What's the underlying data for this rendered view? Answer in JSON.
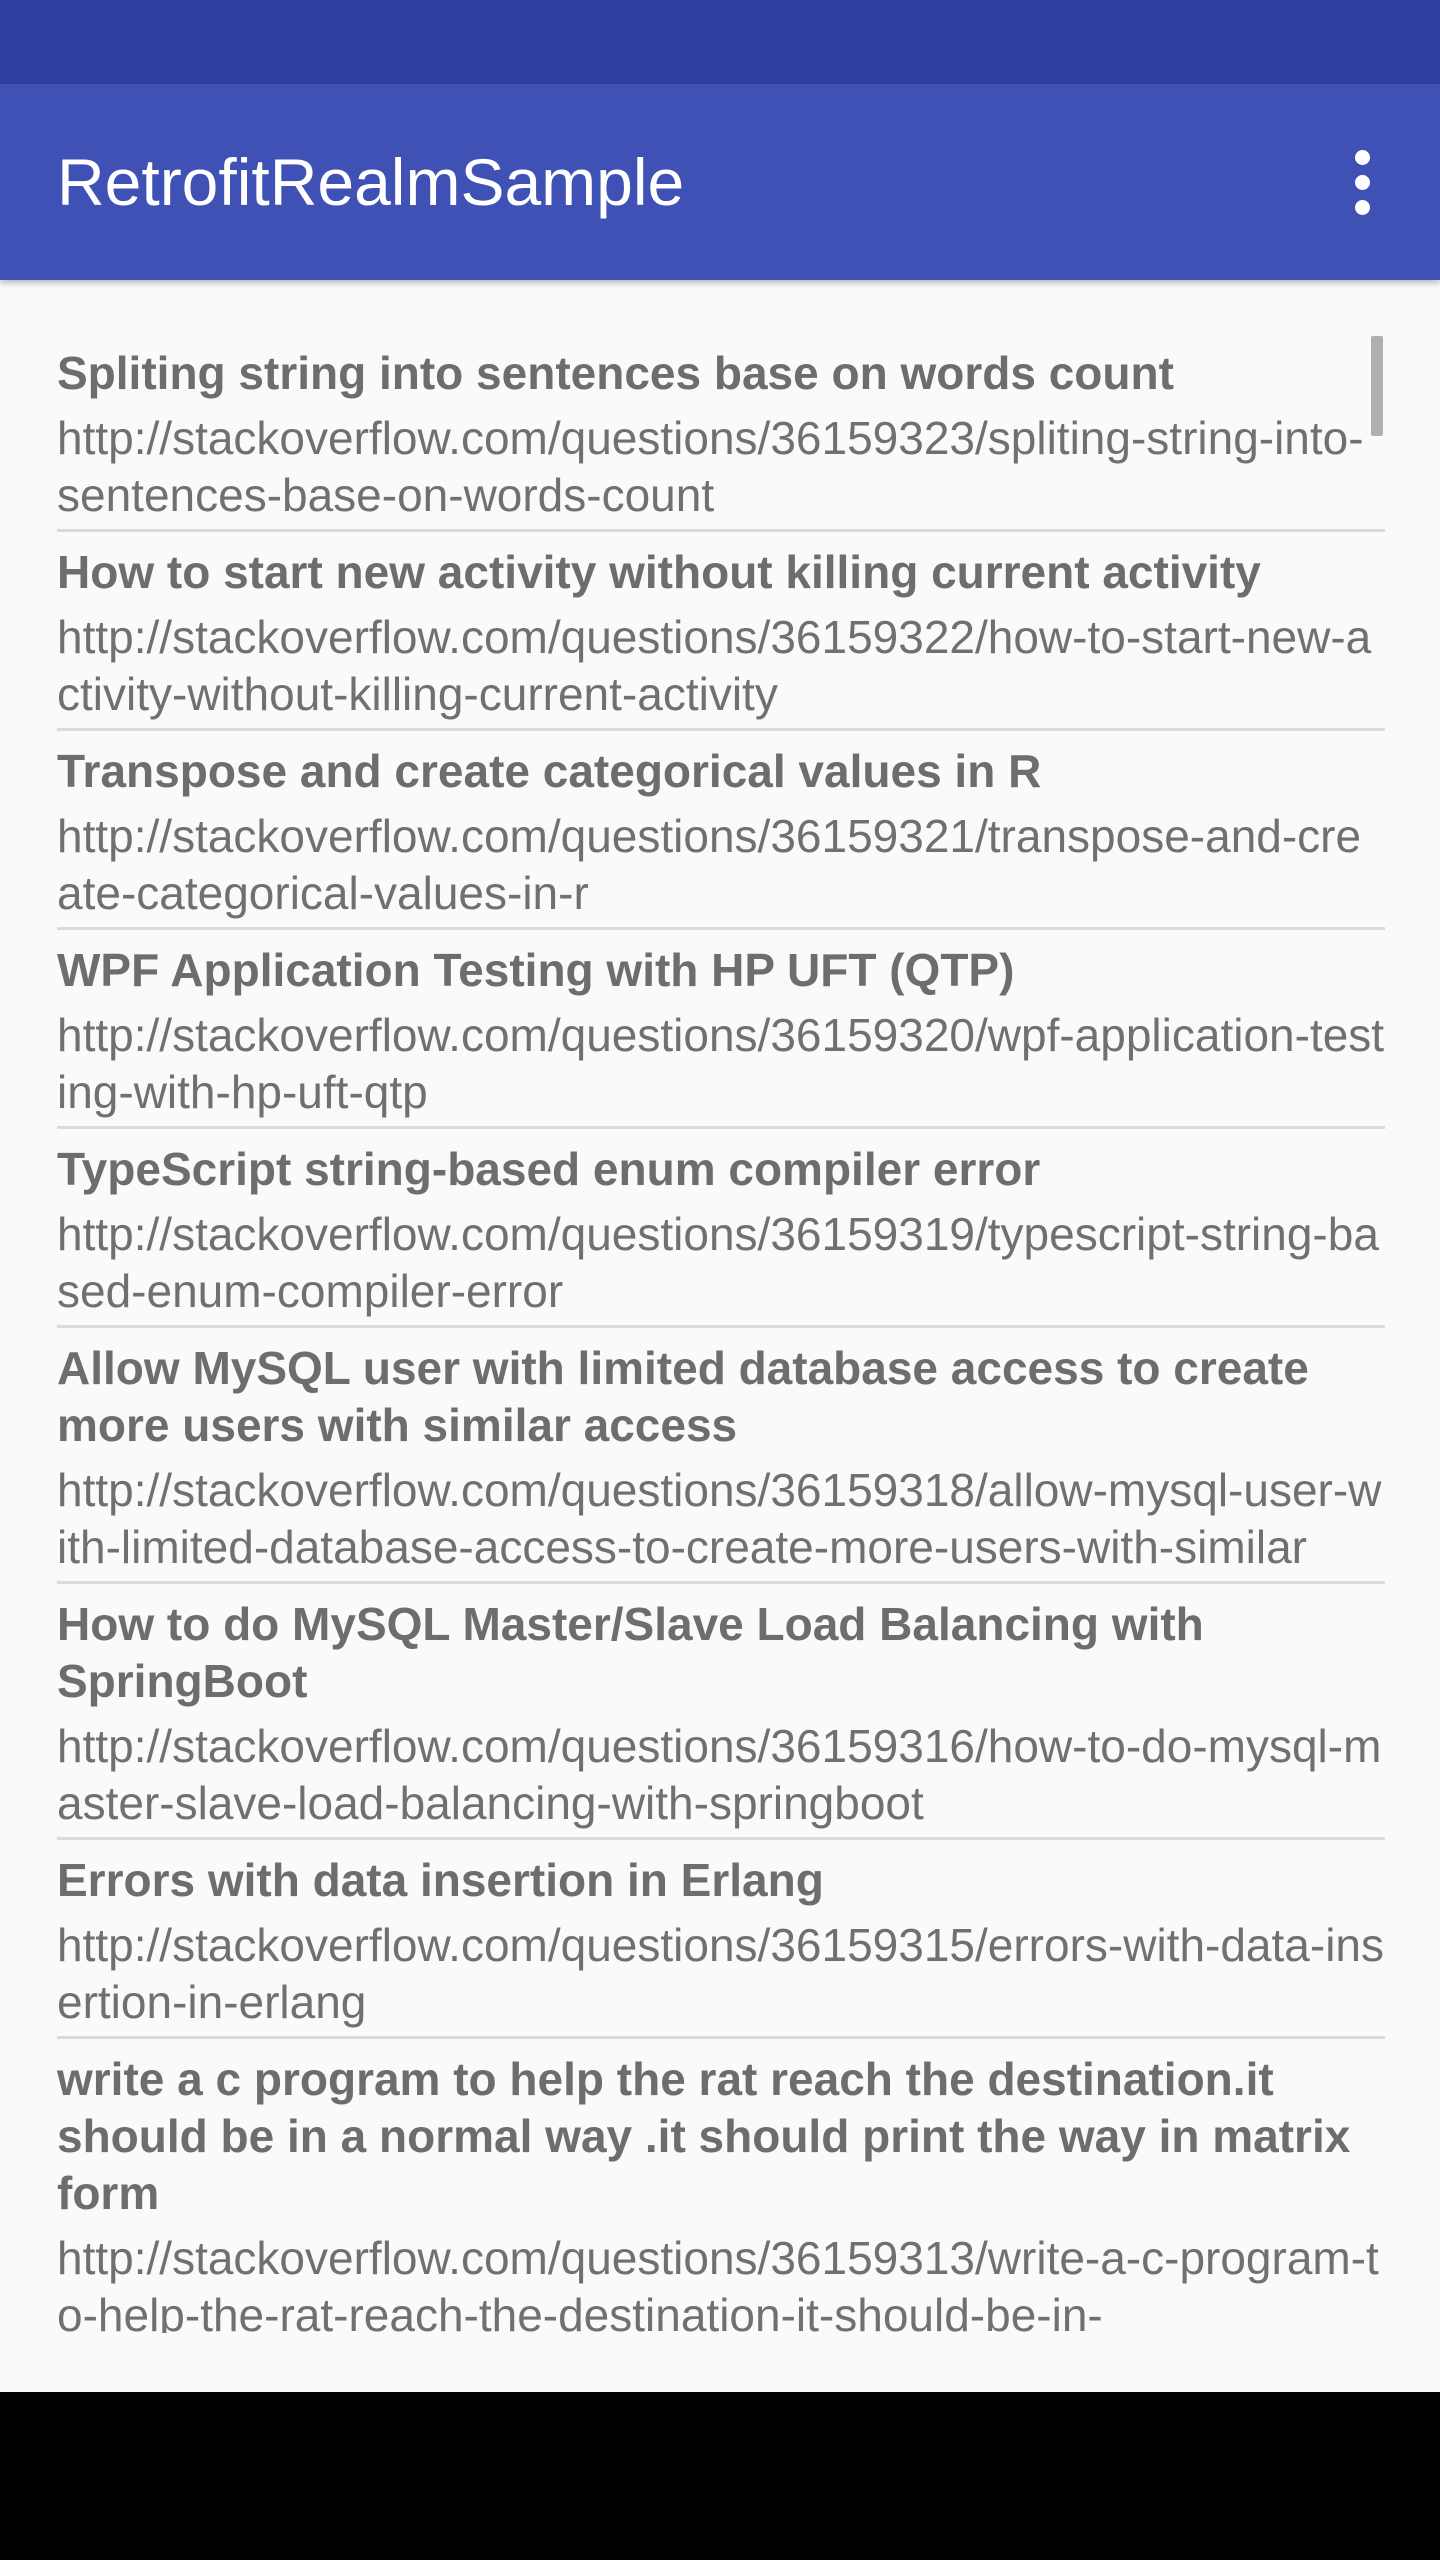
{
  "app": {
    "title": "RetrofitRealmSample"
  },
  "colors": {
    "status_bar": "#303f9f",
    "app_bar": "#3f51b5",
    "background": "#fafafa",
    "text": "#6d6d6d",
    "divider": "#dadada"
  },
  "toolbar": {
    "overflow_icon": "more-vert-icon"
  },
  "list": {
    "items": [
      {
        "title": "Spliting string into sentences base on words count",
        "link": "http://stackoverflow.com/questions/36159323/spliting-string-into-sentences-base-on-words-count"
      },
      {
        "title": "How to start new activity without killing current activity",
        "link": "http://stackoverflow.com/questions/36159322/how-to-start-new-activity-without-killing-current-activity"
      },
      {
        "title": "Transpose and create categorical values in R",
        "link": "http://stackoverflow.com/questions/36159321/transpose-and-create-categorical-values-in-r"
      },
      {
        "title": "WPF Application Testing with HP UFT (QTP)",
        "link": "http://stackoverflow.com/questions/36159320/wpf-application-testing-with-hp-uft-qtp"
      },
      {
        "title": "TypeScript string-based enum compiler error",
        "link": "http://stackoverflow.com/questions/36159319/typescript-string-based-enum-compiler-error"
      },
      {
        "title": "Allow MySQL user with limited database access to create more users with similar access",
        "link": "http://stackoverflow.com/questions/36159318/allow-mysql-user-with-limited-database-access-to-create-more-users-with-similar"
      },
      {
        "title": "How to do MySQL Master/Slave Load Balancing with SpringBoot",
        "link": "http://stackoverflow.com/questions/36159316/how-to-do-mysql-master-slave-load-balancing-with-springboot"
      },
      {
        "title": "Errors with data insertion in Erlang",
        "link": "http://stackoverflow.com/questions/36159315/errors-with-data-insertion-in-erlang"
      },
      {
        "title": "write a c program to help the rat reach the destination.it should be in a normal way .it should print the way in matrix form",
        "link": "http://stackoverflow.com/questions/36159313/write-a-c-program-to-help-the-rat-reach-the-destination-it-should-be-in-"
      }
    ]
  }
}
